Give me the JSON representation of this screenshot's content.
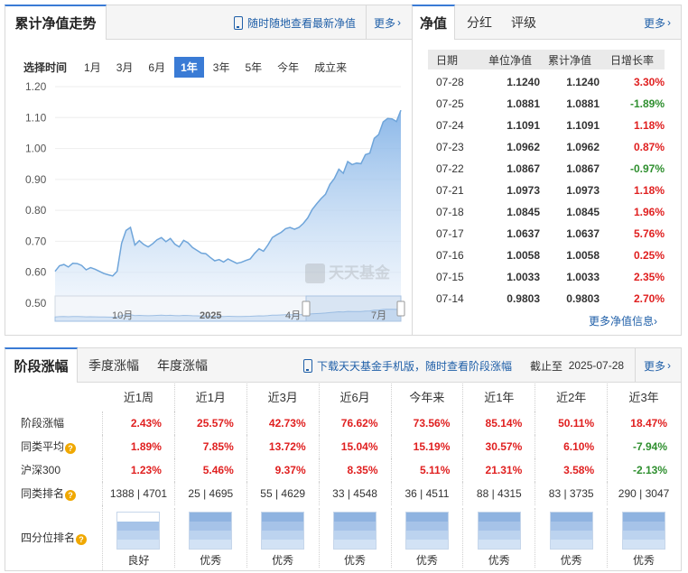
{
  "chart_panel": {
    "title": "累计净值走势",
    "promo_link": "随时随地查看最新净值",
    "more": "更多",
    "range_label": "选择时间",
    "range_options": [
      "1月",
      "3月",
      "6月",
      "1年",
      "3年",
      "5年",
      "今年",
      "成立来"
    ],
    "range_selected": "1年",
    "watermark": "天天基金",
    "navigator_labels": [
      "10月",
      "2025",
      "4月",
      "7月"
    ]
  },
  "chart_data": {
    "type": "area",
    "title": "",
    "xlabel": "",
    "ylabel": "",
    "ylim": [
      0.5,
      1.2
    ],
    "y_ticks": [
      "1.20",
      "1.10",
      "1.00",
      "0.90",
      "0.80",
      "0.70",
      "0.60",
      "0.50"
    ],
    "x_range": [
      "2024-07-29",
      "2025-07-28"
    ],
    "series": [
      {
        "values": [
          0.603,
          0.621,
          0.625,
          0.617,
          0.629,
          0.628,
          0.622,
          0.608,
          0.615,
          0.61,
          0.603,
          0.596,
          0.592,
          0.588,
          0.603,
          0.694,
          0.735,
          0.745,
          0.688,
          0.702,
          0.69,
          0.682,
          0.692,
          0.705,
          0.712,
          0.699,
          0.709,
          0.691,
          0.682,
          0.703,
          0.695,
          0.68,
          0.671,
          0.662,
          0.66,
          0.648,
          0.637,
          0.641,
          0.633,
          0.643,
          0.636,
          0.629,
          0.632,
          0.638,
          0.643,
          0.661,
          0.676,
          0.668,
          0.688,
          0.712,
          0.721,
          0.729,
          0.741,
          0.745,
          0.739,
          0.745,
          0.758,
          0.776,
          0.803,
          0.821,
          0.838,
          0.852,
          0.884,
          0.903,
          0.933,
          0.92,
          0.958,
          0.948,
          0.953,
          0.951,
          0.98,
          0.985,
          1.033,
          1.045,
          1.086,
          1.097,
          1.096,
          1.087,
          1.124
        ]
      }
    ]
  },
  "nav_panel": {
    "tabs": [
      "净值",
      "分红",
      "评级"
    ],
    "active_tab": "净值",
    "more": "更多",
    "headers": [
      "日期",
      "单位净值",
      "累计净值",
      "日增长率"
    ],
    "rows": [
      [
        "07-28",
        "1.1240",
        "1.1240",
        "3.30%"
      ],
      [
        "07-25",
        "1.0881",
        "1.0881",
        "-1.89%"
      ],
      [
        "07-24",
        "1.1091",
        "1.1091",
        "1.18%"
      ],
      [
        "07-23",
        "1.0962",
        "1.0962",
        "0.87%"
      ],
      [
        "07-22",
        "1.0867",
        "1.0867",
        "-0.97%"
      ],
      [
        "07-21",
        "1.0973",
        "1.0973",
        "1.18%"
      ],
      [
        "07-18",
        "1.0845",
        "1.0845",
        "1.96%"
      ],
      [
        "07-17",
        "1.0637",
        "1.0637",
        "5.76%"
      ],
      [
        "07-16",
        "1.0058",
        "1.0058",
        "0.25%"
      ],
      [
        "07-15",
        "1.0033",
        "1.0033",
        "2.35%"
      ],
      [
        "07-14",
        "0.9803",
        "0.9803",
        "2.70%"
      ]
    ],
    "more_nav": "更多净值信息"
  },
  "stage_panel": {
    "tabs": [
      "阶段涨幅",
      "季度涨幅",
      "年度涨幅"
    ],
    "active_tab": "阶段涨幅",
    "download_text": "下载天天基金手机版，随时查看阶段涨幅",
    "as_of_label": "截止至",
    "as_of_date": "2025-07-28",
    "more": "更多",
    "columns": [
      "近1周",
      "近1月",
      "近3月",
      "近6月",
      "今年来",
      "近1年",
      "近2年",
      "近3年"
    ],
    "rows": [
      {
        "label": "阶段涨幅",
        "info": false,
        "bold": true,
        "values": [
          "2.43%",
          "25.57%",
          "42.73%",
          "76.62%",
          "73.56%",
          "85.14%",
          "50.11%",
          "18.47%"
        ]
      },
      {
        "label": "同类平均",
        "info": true,
        "bold": true,
        "values": [
          "1.89%",
          "7.85%",
          "13.72%",
          "15.04%",
          "15.19%",
          "30.57%",
          "6.10%",
          "-7.94%"
        ]
      },
      {
        "label": "沪深300",
        "info": false,
        "bold": true,
        "values": [
          "1.23%",
          "5.46%",
          "9.37%",
          "8.35%",
          "5.11%",
          "21.31%",
          "3.58%",
          "-2.13%"
        ]
      },
      {
        "label": "同类排名",
        "info": true,
        "bold": false,
        "values": [
          "1388 | 4701",
          "25 | 4695",
          "55 | 4629",
          "33 | 4548",
          "36 | 4511",
          "88 | 4315",
          "83 | 3735",
          "290 | 3047"
        ]
      }
    ],
    "quartile_label": "四分位排名",
    "quartiles": [
      {
        "label": "良好",
        "level": 3
      },
      {
        "label": "优秀",
        "level": 4
      },
      {
        "label": "优秀",
        "level": 4
      },
      {
        "label": "优秀",
        "level": 4
      },
      {
        "label": "优秀",
        "level": 4
      },
      {
        "label": "优秀",
        "level": 4
      },
      {
        "label": "优秀",
        "level": 4
      },
      {
        "label": "优秀",
        "level": 4
      }
    ]
  },
  "colors": {
    "accent": "#3a7bd5",
    "link": "#1f5fa8",
    "positive": "#e02020",
    "negative": "#2f8f2f",
    "line": "#6fa5da",
    "quartile_on": "#8fb3e0",
    "quartile_off": "#dde8f6"
  }
}
